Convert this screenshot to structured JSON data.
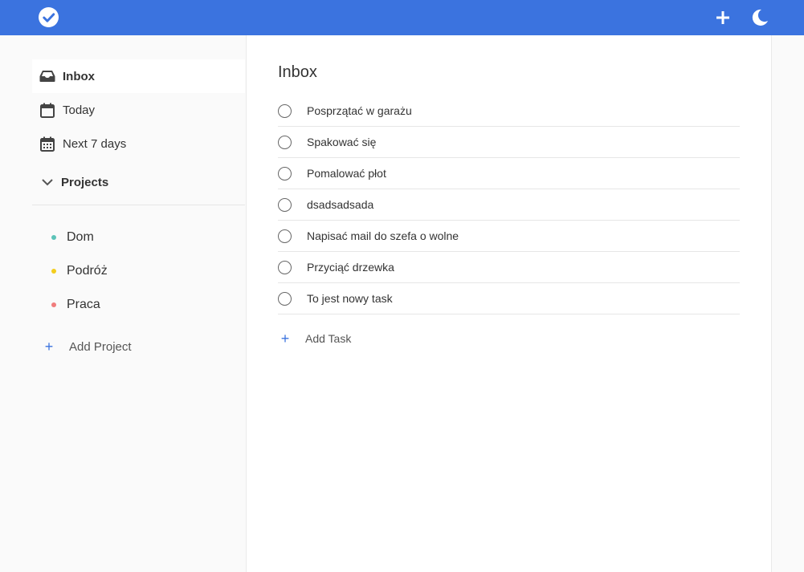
{
  "colors": {
    "accent": "#3b73df",
    "dom": "#5cc3b8",
    "podroz": "#f3cd1d",
    "praca": "#f07c7c"
  },
  "header": {
    "logo_icon": "check-circle-icon",
    "add_icon": "plus-icon",
    "theme_icon": "moon-icon"
  },
  "sidebar": {
    "items": [
      {
        "label": "Inbox",
        "icon": "inbox-icon"
      },
      {
        "label": "Today",
        "icon": "calendar-icon"
      },
      {
        "label": "Next 7 days",
        "icon": "calendar-week-icon"
      }
    ],
    "projects_label": "Projects",
    "projects": [
      {
        "label": "Dom"
      },
      {
        "label": "Podróż"
      },
      {
        "label": "Praca"
      }
    ],
    "add_project": "Add Project"
  },
  "main": {
    "title": "Inbox",
    "tasks": [
      "Posprzątać w garażu",
      "Spakować się",
      "Pomalować płot",
      "dsadsadsada",
      "Napisać mail do szefa o wolne",
      "Przyciąć drzewka",
      "To jest nowy task"
    ],
    "add_task": "Add Task"
  }
}
